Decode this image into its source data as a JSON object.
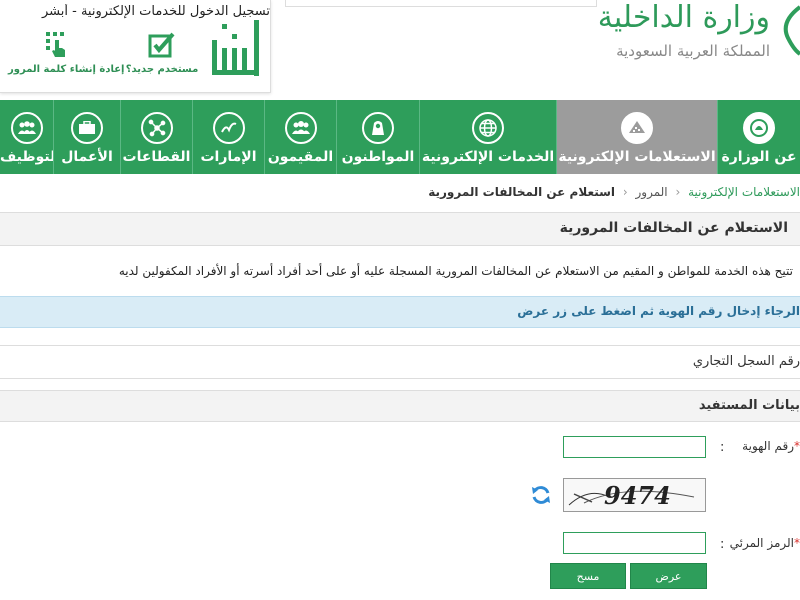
{
  "header": {
    "login_title": "تسجيل الدخول للخدمات الإلكترونية - أبشر",
    "new_user_label": "مستخدم جديد؟",
    "reset_password_label": "إعادة إنشاء كلمة المرور",
    "ministry_name": "وزارة الداخلية",
    "ministry_subtitle": "المملكة العربية السعودية",
    "brand_color": "#2e9e5b",
    "absher_logo_icon": "absher-logo",
    "new_user_icon": "edit-check-icon",
    "reset_password_icon": "hand-keypad-icon"
  },
  "nav": {
    "items": [
      {
        "label": "عن الوزارة",
        "icon": "ministry-emblem-icon",
        "active": false
      },
      {
        "label": "الاستعلامات الإلكترونية",
        "icon": "inquiries-icon",
        "active": true
      },
      {
        "label": "الخدمات الإلكترونية",
        "icon": "globe-icon",
        "active": false
      },
      {
        "label": "المواطنون",
        "icon": "citizen-icon",
        "active": false
      },
      {
        "label": "المقيمون",
        "icon": "residents-icon",
        "active": false
      },
      {
        "label": "الإمارات",
        "icon": "emirates-icon",
        "active": false
      },
      {
        "label": "القطاعات",
        "icon": "sectors-icon",
        "active": false
      },
      {
        "label": "الأعمال",
        "icon": "briefcase-icon",
        "active": false
      },
      {
        "label": "التوظيف",
        "icon": "employment-icon",
        "active": false
      }
    ]
  },
  "breadcrumb": {
    "link1": "الاستعلامات الإلكترونية",
    "link2": "المرور",
    "current": "استعلام عن المخالفات المرورية"
  },
  "page": {
    "title": "الاستعلام عن المخالفات المرورية",
    "description": "تتيح هذه الخدمة للمواطن و المقيم من الاستعلام عن المخالفات المرورية المسجلة عليه أو على أحد أفراد أسرته أو الأفراد المكفولين لديه",
    "info_text": "الرجاء إدخال رقم الهوية ثم اضغط على زر عرض",
    "radio_option": "رقم السجل التجاري",
    "beneficiary_header": "بيانات المستفيد"
  },
  "form": {
    "id_label": "رقم الهوية",
    "id_value": "",
    "captcha_text": "9474",
    "captcha_label": "الرمز المرئي",
    "captcha_value": "",
    "colon": ":",
    "required_mark": "*",
    "submit_label": "عرض",
    "clear_label": "مسح"
  }
}
